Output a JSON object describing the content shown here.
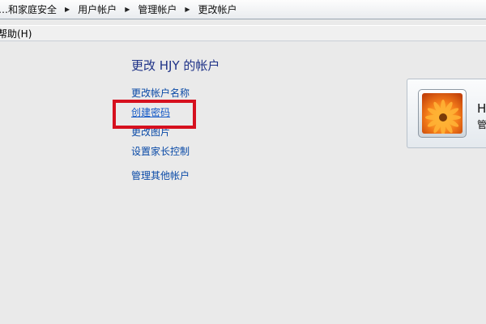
{
  "breadcrumb": {
    "items": [
      "…和家庭安全",
      "用户帐户",
      "管理帐户",
      "更改帐户"
    ]
  },
  "menubar": {
    "help": "帮助(H)"
  },
  "main": {
    "heading": "更改 HJY 的帐户",
    "tasks": {
      "rename": "更改帐户名称",
      "create_password": "创建密码",
      "change_picture": "更改图片",
      "parental_controls": "设置家长控制",
      "manage_other": "管理其他帐户"
    }
  },
  "account": {
    "name": "H",
    "type": "管"
  },
  "colors": {
    "highlight_box": "#d6101e",
    "link": "#0a4aa7",
    "heading": "#1e3287"
  },
  "icons": {
    "separator": "triangle-right-icon",
    "avatar": "orange-flower-avatar"
  }
}
